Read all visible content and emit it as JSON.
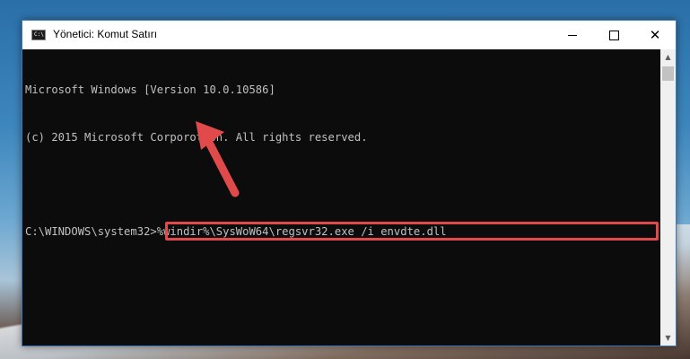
{
  "window": {
    "title": "Yönetici: Komut Satırı",
    "icon_label": "C:\\",
    "controls": {
      "minimize": "minimize-icon",
      "maximize": "maximize-icon",
      "close": "✕"
    }
  },
  "console": {
    "lines": [
      "Microsoft Windows [Version 10.0.10586]",
      "(c) 2015 Microsoft Corporotion. All rights reserved.",
      ""
    ],
    "prompt": "C:\\WINDOWS\\system32>",
    "command": "%windir%\\SysWoW64\\regsvr32.exe /i envdte.dll"
  },
  "annotation": {
    "highlight_color": "#e04a4a",
    "arrow_color": "#e04a4a",
    "arrow_icon": "red-arrow-icon"
  }
}
